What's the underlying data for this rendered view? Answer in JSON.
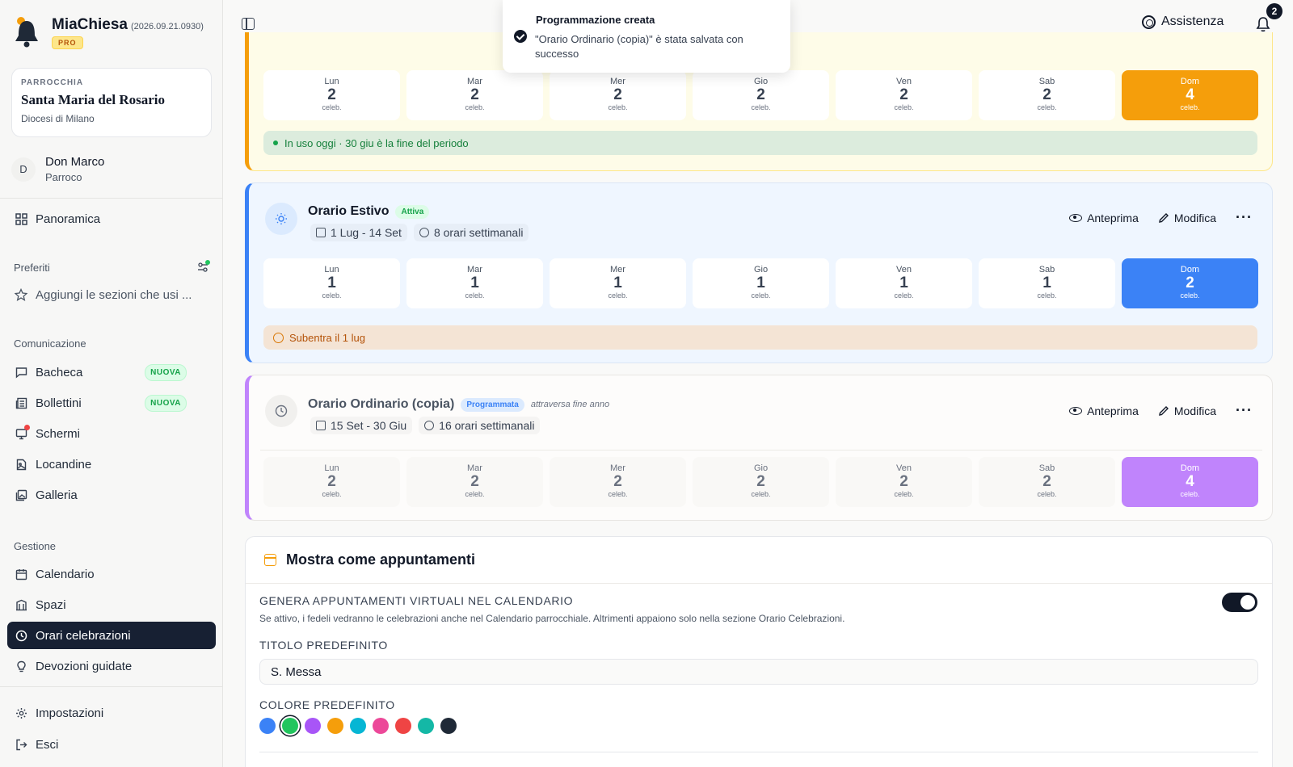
{
  "app": {
    "name": "MiaChiesa",
    "version": "(2026.09.21.0930)",
    "plan_badge": "PRO"
  },
  "parish": {
    "label": "PARROCCHIA",
    "name": "Santa Maria del Rosario",
    "diocese": "Diocesi di Milano"
  },
  "user": {
    "initial": "D",
    "name": "Don Marco",
    "role": "Parroco"
  },
  "nav": {
    "overview": "Panoramica",
    "favorites_label": "Preferiti",
    "favorites_add": "Aggiungi le sezioni che usi ...",
    "communication_label": "Comunicazione",
    "bacheca": "Bacheca",
    "bollettini": "Bollettini",
    "new_badge": "NUOVA",
    "schermi": "Schermi",
    "locandine": "Locandine",
    "galleria": "Galleria",
    "management_label": "Gestione",
    "calendario": "Calendario",
    "spazi": "Spazi",
    "orari": "Orari celebrazioni",
    "devozioni": "Devozioni guidate",
    "impostazioni": "Impostazioni",
    "esci": "Esci"
  },
  "topbar": {
    "assistance": "Assistenza",
    "notifications_count": "2"
  },
  "toast": {
    "title": "Programmazione creata",
    "message": "\"Orario Ordinario (copia)\" è stata salvata con successo"
  },
  "colors": {
    "yellow_accent": "#f59e0b",
    "blue_accent": "#3b82f6",
    "violet_accent": "#c084fc",
    "sidebar_active": "#172033"
  },
  "celebrations_unit": "celeb.",
  "schedules": [
    {
      "days": [
        {
          "name": "Lun",
          "value": "2"
        },
        {
          "name": "Mar",
          "value": "2"
        },
        {
          "name": "Mer",
          "value": "2"
        },
        {
          "name": "Gio",
          "value": "2"
        },
        {
          "name": "Ven",
          "value": "2"
        },
        {
          "name": "Sab",
          "value": "2"
        },
        {
          "name": "Dom",
          "value": "4"
        }
      ],
      "status": "In uso oggi · 30 giu è la fine del periodo"
    },
    {
      "title": "Orario Estivo",
      "badge": "Attiva",
      "period": "1 Lug - 14 Set",
      "weekly": "8 orari settimanali",
      "preview": "Anteprima",
      "edit": "Modifica",
      "days": [
        {
          "name": "Lun",
          "value": "1"
        },
        {
          "name": "Mar",
          "value": "1"
        },
        {
          "name": "Mer",
          "value": "1"
        },
        {
          "name": "Gio",
          "value": "1"
        },
        {
          "name": "Ven",
          "value": "1"
        },
        {
          "name": "Sab",
          "value": "1"
        },
        {
          "name": "Dom",
          "value": "2"
        }
      ],
      "status": "Subentra il 1 lug"
    },
    {
      "title": "Orario Ordinario (copia)",
      "badge": "Programmata",
      "note": "attraversa fine anno",
      "period": "15 Set - 30 Giu",
      "weekly": "16 orari settimanali",
      "preview": "Anteprima",
      "edit": "Modifica",
      "days": [
        {
          "name": "Lun",
          "value": "2"
        },
        {
          "name": "Mar",
          "value": "2"
        },
        {
          "name": "Mer",
          "value": "2"
        },
        {
          "name": "Gio",
          "value": "2"
        },
        {
          "name": "Ven",
          "value": "2"
        },
        {
          "name": "Sab",
          "value": "2"
        },
        {
          "name": "Dom",
          "value": "4"
        }
      ]
    }
  ],
  "appointments": {
    "title": "Mostra come appuntamenti",
    "virtual_label": "GENERA APPUNTAMENTI VIRTUALI NEL CALENDARIO",
    "virtual_hint": "Se attivo, i fedeli vedranno le celebrazioni anche nel Calendario parrocchiale. Altrimenti appaiono solo nella sezione Orario Celebrazioni.",
    "virtual_enabled": true,
    "default_title_label": "TITOLO PREDEFINITO",
    "default_title_value": "S. Messa",
    "default_color_label": "COLORE PREDEFINITO",
    "color_options": [
      "#3b82f6",
      "#22c55e",
      "#a855f7",
      "#f59e0b",
      "#06b6d4",
      "#ec4899",
      "#ef4444",
      "#14b8a6",
      "#1f2937"
    ],
    "selected_color": "#22c55e"
  }
}
